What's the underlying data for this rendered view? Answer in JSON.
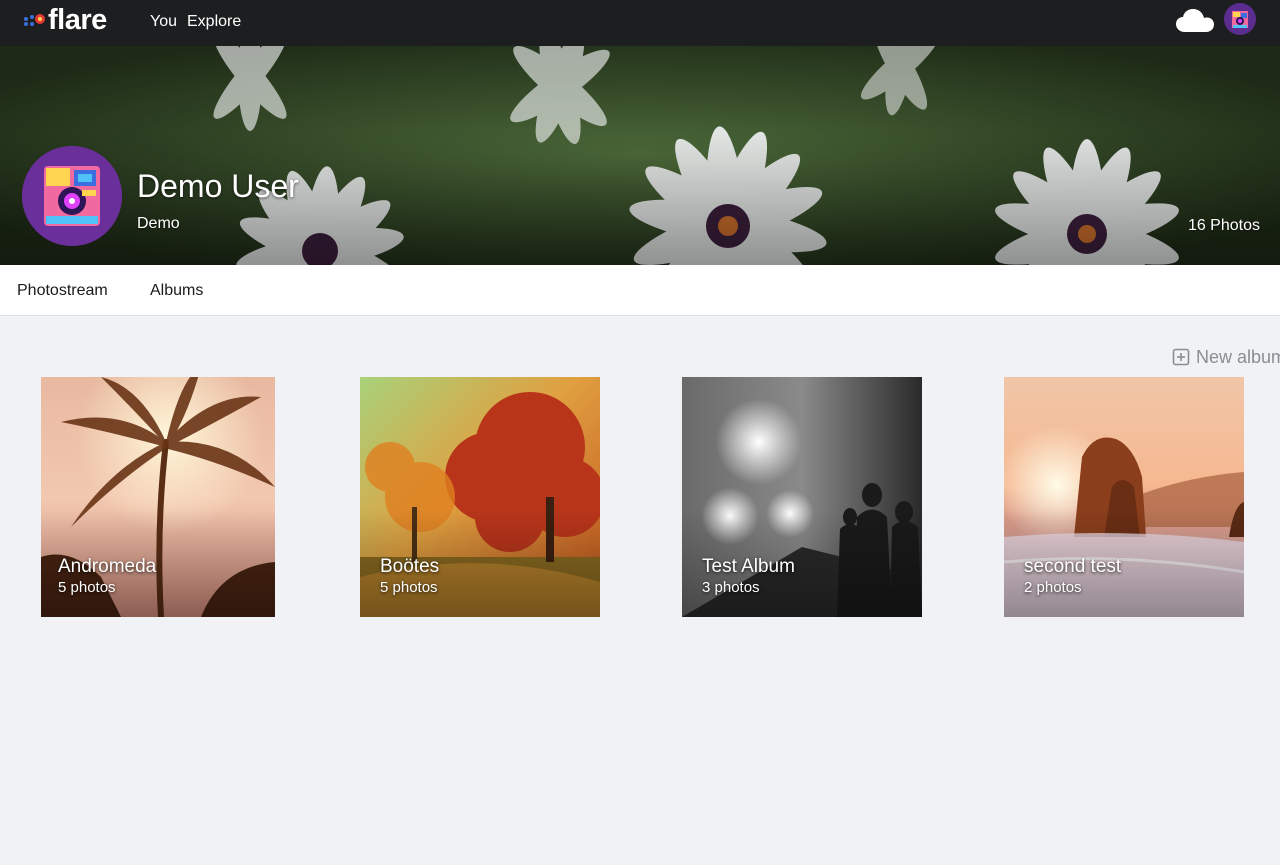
{
  "app": {
    "logo_text": "flare",
    "nav": {
      "you": "You",
      "explore": "Explore"
    }
  },
  "profile": {
    "name": "Demo User",
    "handle": "Demo",
    "photo_count": "16 Photos"
  },
  "tabs": {
    "photostream": "Photostream",
    "albums": "Albums"
  },
  "actions": {
    "new_album": "New album"
  },
  "albums": [
    {
      "title": "Andromeda",
      "count": "5 photos"
    },
    {
      "title": "Boötes",
      "count": "5 photos"
    },
    {
      "title": "Test Album",
      "count": "3 photos"
    },
    {
      "title": "second test",
      "count": "2 photos"
    }
  ],
  "colors": {
    "topbar": "#1c1e20",
    "page_bg": "#f0f2f5",
    "muted_text": "#8a8d91"
  }
}
